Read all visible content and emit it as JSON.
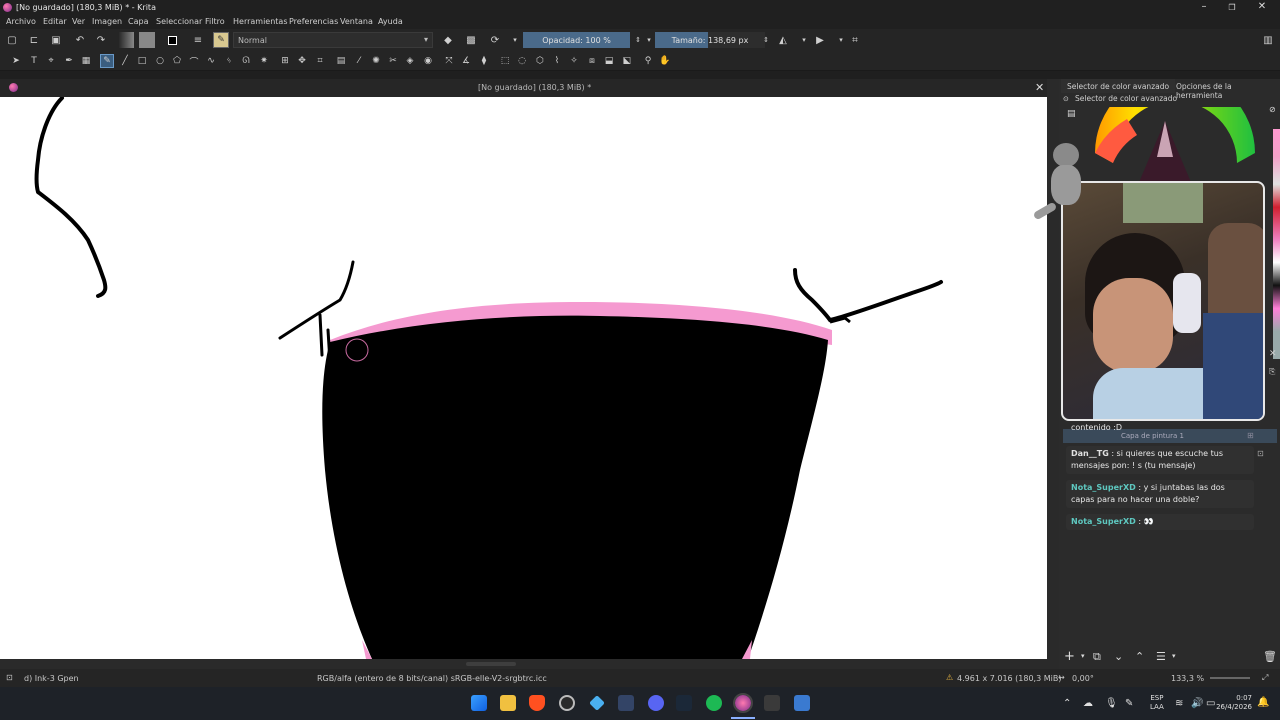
{
  "window": {
    "title": "[No guardado]  (180,3 MiB) * - Krita"
  },
  "menu": {
    "items": [
      "Archivo",
      "Editar",
      "Ver",
      "Imagen",
      "Capa",
      "Seleccionar",
      "Filtro",
      "Herramientas",
      "Preferencias",
      "Ventana",
      "Ayuda"
    ]
  },
  "toolbar": {
    "blend_mode": "Normal",
    "opacity_label": "Opacidad: 100 %",
    "size_label": "Tamaño: 138,69 px"
  },
  "document_tab": {
    "label": "[No guardado]  (180,3 MiB) *"
  },
  "dock": {
    "tab_color_selector": "Selector de color avanzado",
    "tab_tool_options": "Opciones de la herramienta",
    "panel_title": "Selector de color avanzado",
    "layer_name": "Capa de pintura 1"
  },
  "chat": {
    "messages": [
      {
        "user": "",
        "text": "contenido :D"
      },
      {
        "user": "Dan__TG",
        "text": ": si quieres que escuche tus mensajes pon: ! s (tu mensaje)"
      },
      {
        "user": "Nota_SuperXD",
        "text": ": y si juntabas las dos capas para no hacer una doble?"
      },
      {
        "user": "Nota_SuperXD",
        "text": ": 👀"
      }
    ]
  },
  "statusbar": {
    "brush": "d) Ink-3 Gpen",
    "color_profile": "RGB/alfa (entero de 8 bits/canal)  sRGB-elle-V2-srgbtrc.icc",
    "dimensions": "4.961 x 7.016 (180,3 MiB)",
    "rotation": "0,00°",
    "zoom": "133,3 %"
  },
  "taskbar": {
    "lang_top": "ESP",
    "lang_bottom": "LAA",
    "time": "0:07",
    "date": "26/4/2026"
  },
  "colors": {
    "accent_slider": "#4a6a8a",
    "pink_stroke": "#f59ad0",
    "chat_user": "#5ec8c0"
  }
}
